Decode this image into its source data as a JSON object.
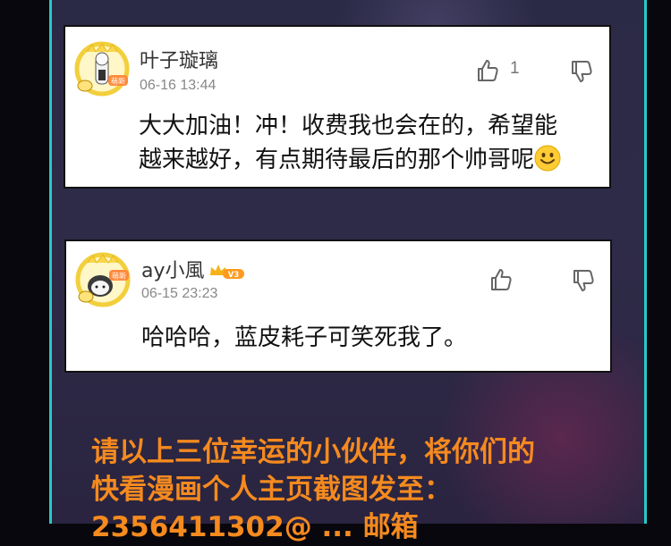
{
  "comments": [
    {
      "username": "叶子璇璃",
      "avatar_badge": "萌新",
      "timestamp": "06-16 13:44",
      "like_count": "1",
      "text_line1": "大大加油！冲！收费我也会在的，希望能",
      "text_line2": "越来越好，有点期待最后的那个帅哥呢",
      "emoji": "smiley-emoji"
    },
    {
      "username": "ay小風",
      "avatar_badge": "萌新",
      "vip_badge": "V3",
      "timestamp": "06-15 23:23",
      "text_line1": "哈哈哈，蓝皮耗子可笑死我了。"
    }
  ],
  "announcement": {
    "line1": "请以上三位幸运的小伙伴，将你们的",
    "line2": "快看漫画个人主页截图发至：",
    "line3": "2356411302@ ... 邮箱"
  },
  "colors": {
    "panel_border": "#27c9c9",
    "panel_bg": "#2e2b48",
    "announcement_text": "#f58a1f",
    "card_bg": "#ffffff"
  },
  "icons": [
    "chick-avatar-icon",
    "thumbs-up-icon",
    "thumbs-down-icon",
    "crown-icon",
    "smiley-emoji"
  ]
}
